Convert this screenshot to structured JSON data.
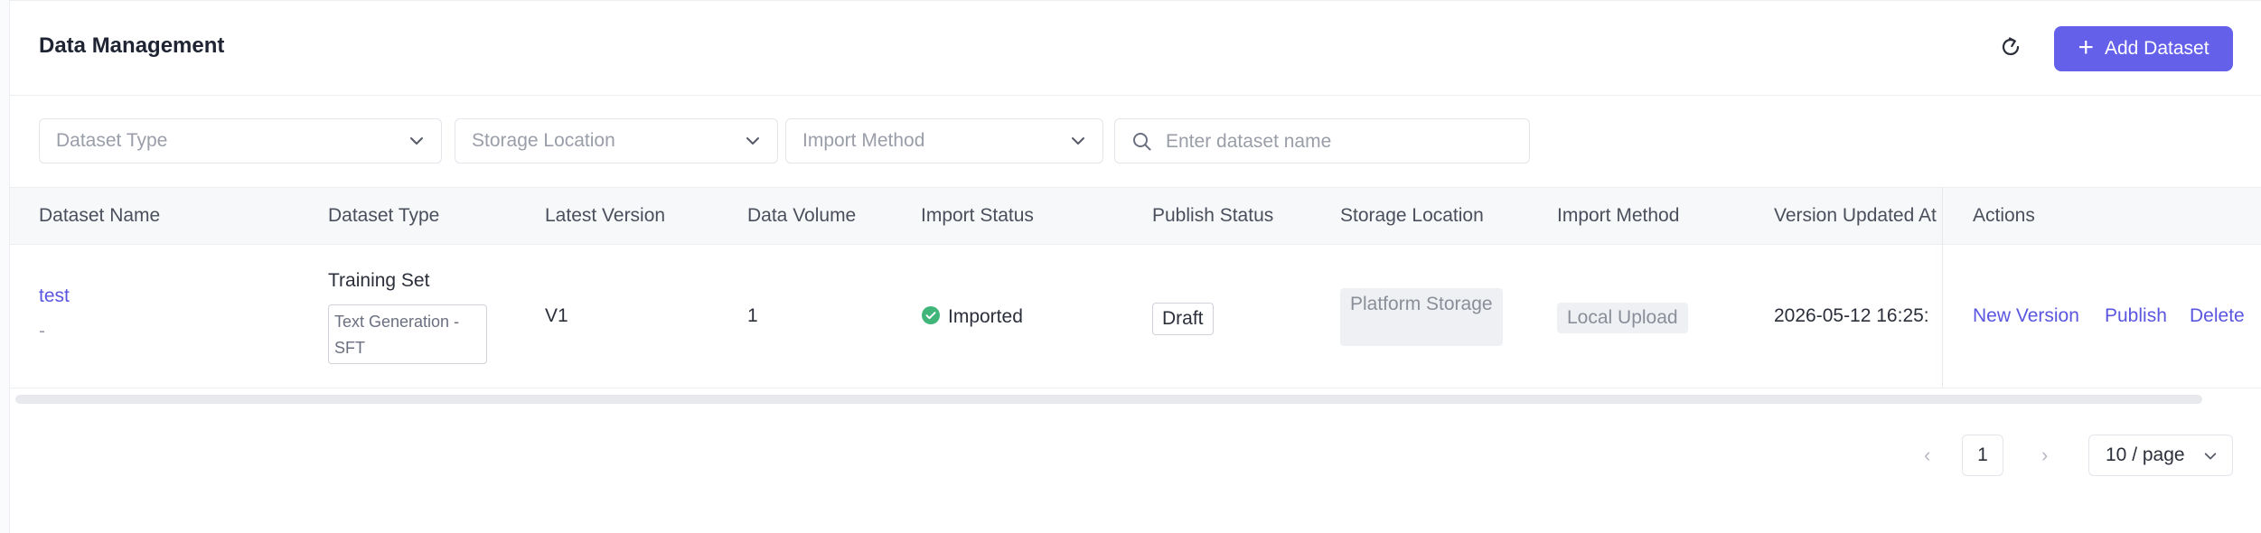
{
  "header": {
    "title": "Data Management",
    "refresh_icon": "refresh-icon",
    "add_label": "Add Dataset"
  },
  "filters": {
    "dataset_type": "Dataset Type",
    "storage_location": "Storage Location",
    "import_method": "Import Method",
    "search_placeholder": "Enter dataset name"
  },
  "table": {
    "columns": [
      "Dataset Name",
      "Dataset Type",
      "Latest Version",
      "Data Volume",
      "Import Status",
      "Publish Status",
      "Storage Location",
      "Import Method",
      "Version Updated At",
      "Actions"
    ],
    "rows": [
      {
        "name": "test",
        "description": "-",
        "type": "Training Set",
        "subtype": "Text Generation - SFT",
        "version": "V1",
        "volume": "1",
        "import_status": "Imported",
        "publish_status": "Draft",
        "storage": "Platform Storage",
        "import_method": "Local Upload",
        "updated_at": "2026-05-12 16:25:",
        "actions": [
          "New Version",
          "Publish",
          "Delete"
        ]
      }
    ]
  },
  "pagination": {
    "current_page": "1",
    "page_size": "10 / page"
  },
  "colors": {
    "accent": "#6460ea",
    "success": "#3fb57a"
  }
}
